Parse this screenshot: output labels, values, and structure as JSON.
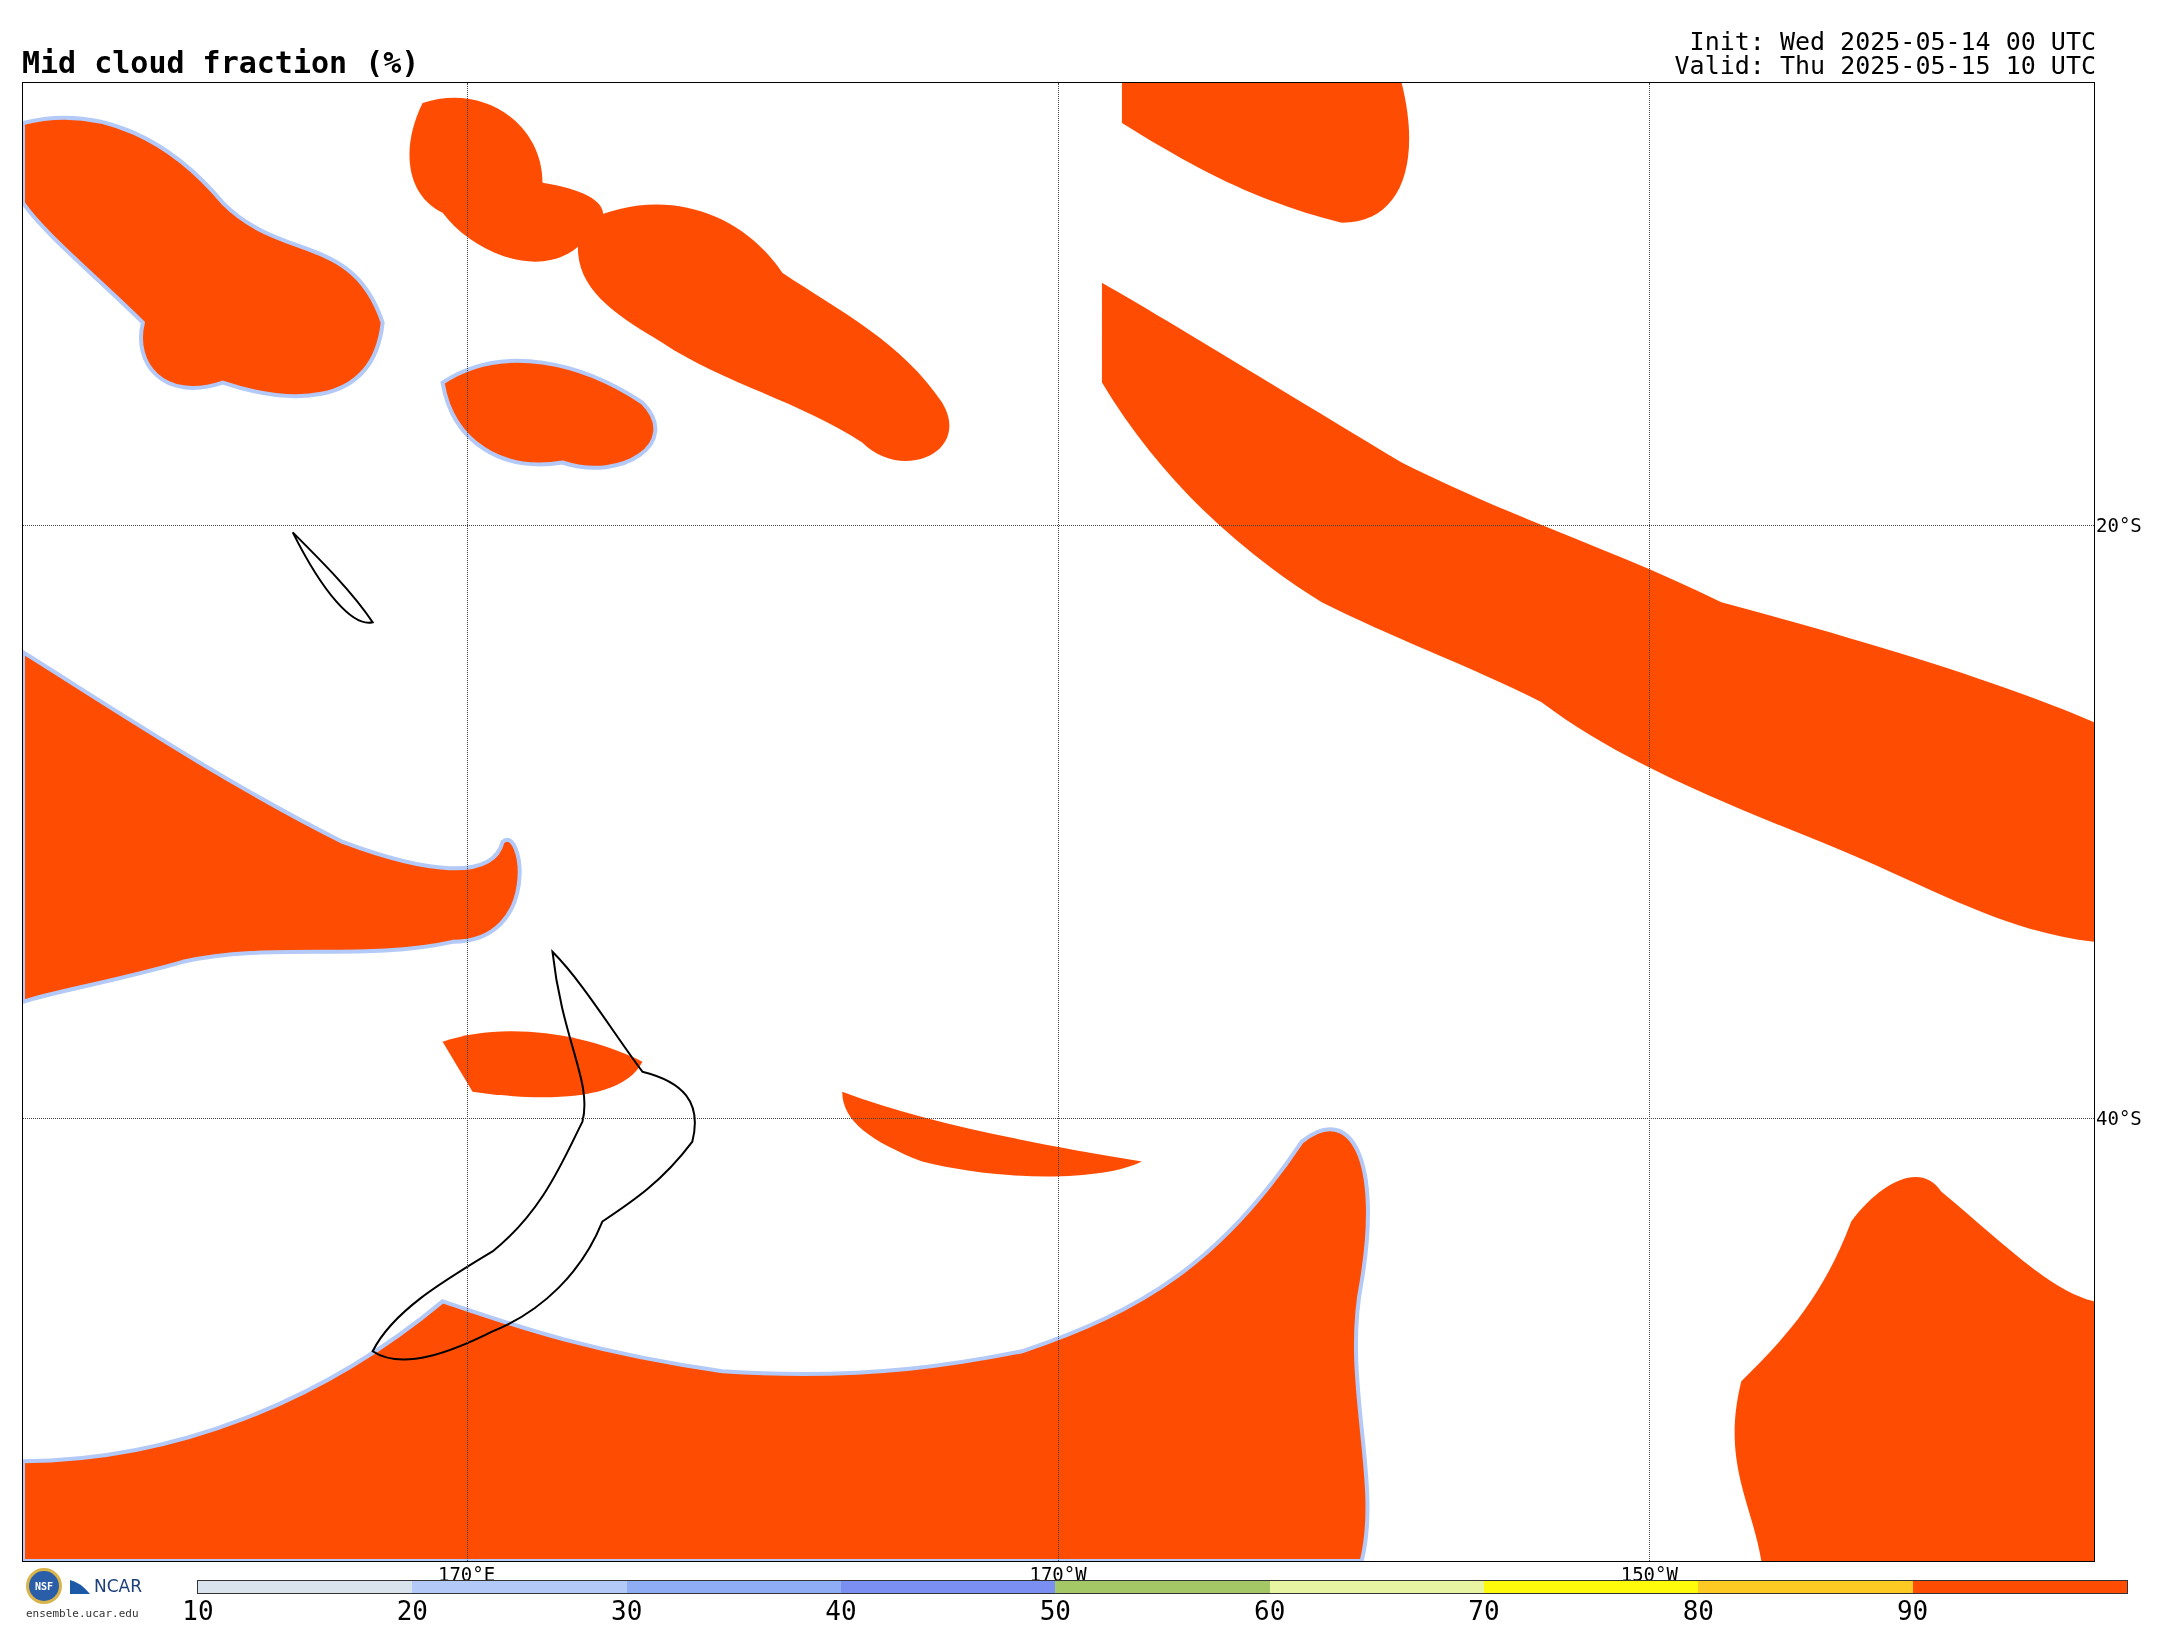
{
  "title": "Mid cloud fraction (%)",
  "init": "Init: Wed 2025-05-14 00 UTC",
  "valid": "Valid: Thu 2025-05-15 10 UTC",
  "map": {
    "lat_labels": [
      "20°S",
      "40°S"
    ],
    "lon_labels": [
      "170°E",
      "170°W",
      "150°W"
    ]
  },
  "logos": {
    "nsf": "NSF",
    "ncar": "NCAR",
    "site": "ensemble.ucar.edu"
  },
  "colorbar": {
    "segments": [
      {
        "label": "10",
        "color": "#d8e3ee"
      },
      {
        "label": "20",
        "color": "#b3c9f7"
      },
      {
        "label": "30",
        "color": "#8eadf5"
      },
      {
        "label": "40",
        "color": "#7b8ff2"
      },
      {
        "label": "50",
        "color": "#a5c866"
      },
      {
        "label": "60",
        "color": "#e8f5a3"
      },
      {
        "label": "70",
        "color": "#fffb0a"
      },
      {
        "label": "80",
        "color": "#fdca24"
      },
      {
        "label": "90",
        "color": "#fe4c03"
      }
    ]
  }
}
